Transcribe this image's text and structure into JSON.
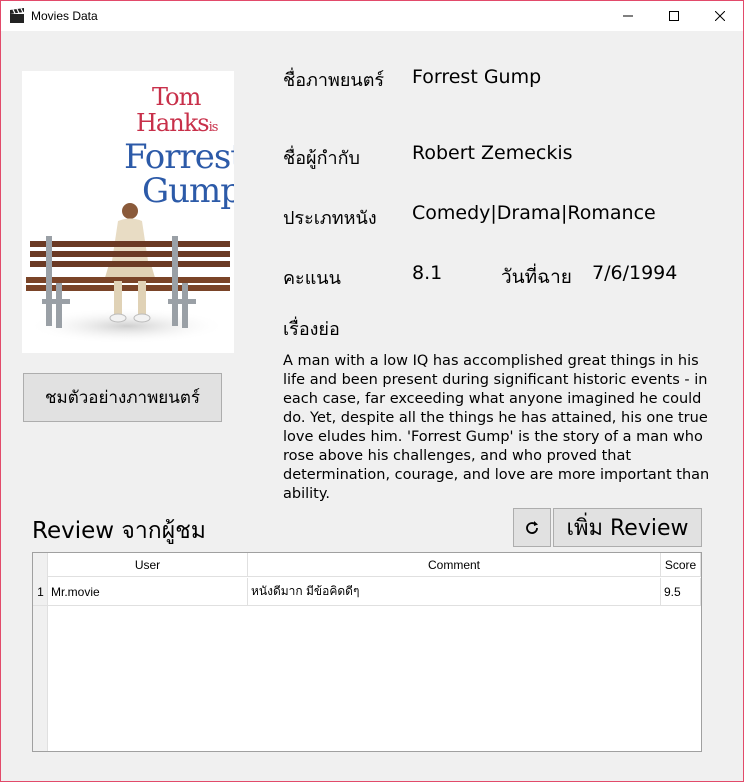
{
  "window": {
    "title": "Movies Data"
  },
  "poster": {
    "line1": "Tom",
    "line2": "Hanks",
    "line2_small": "is",
    "line3": "Forrest",
    "line4": "Gump"
  },
  "details": {
    "title_label": "ชื่อภาพยนตร์",
    "title_value": "Forrest Gump",
    "director_label": "ชื่อผู้กำกับ",
    "director_value": "Robert Zemeckis",
    "genre_label": "ประเภทหนัง",
    "genre_value": "Comedy|Drama|Romance",
    "score_label": "คะแนน",
    "score_value": "8.1",
    "release_label": "วันที่ฉาย",
    "release_value": "7/6/1994",
    "synopsis_label": "เรื่องย่อ",
    "synopsis_text": "A man with a low IQ has accomplished great things in his life and been present during significant historic events - in each case, far exceeding what anyone imagined he could do. Yet, despite all the things he has attained, his one true love eludes him. 'Forrest Gump' is the story of a man who rose above his challenges, and who proved that determination, courage, and love are more important than ability."
  },
  "trailer_button": "ชมตัวอย่างภาพยนตร์",
  "reviews": {
    "title": "Review จากผู้ชม",
    "add_button": "เพิ่ม Review",
    "columns": {
      "user": "User",
      "comment": "Comment",
      "score": "Score"
    },
    "rows": [
      {
        "num": "1",
        "user": "Mr.movie",
        "comment": "หนังดีมาก มีข้อคิดดีๆ",
        "score": "9.5"
      }
    ]
  }
}
